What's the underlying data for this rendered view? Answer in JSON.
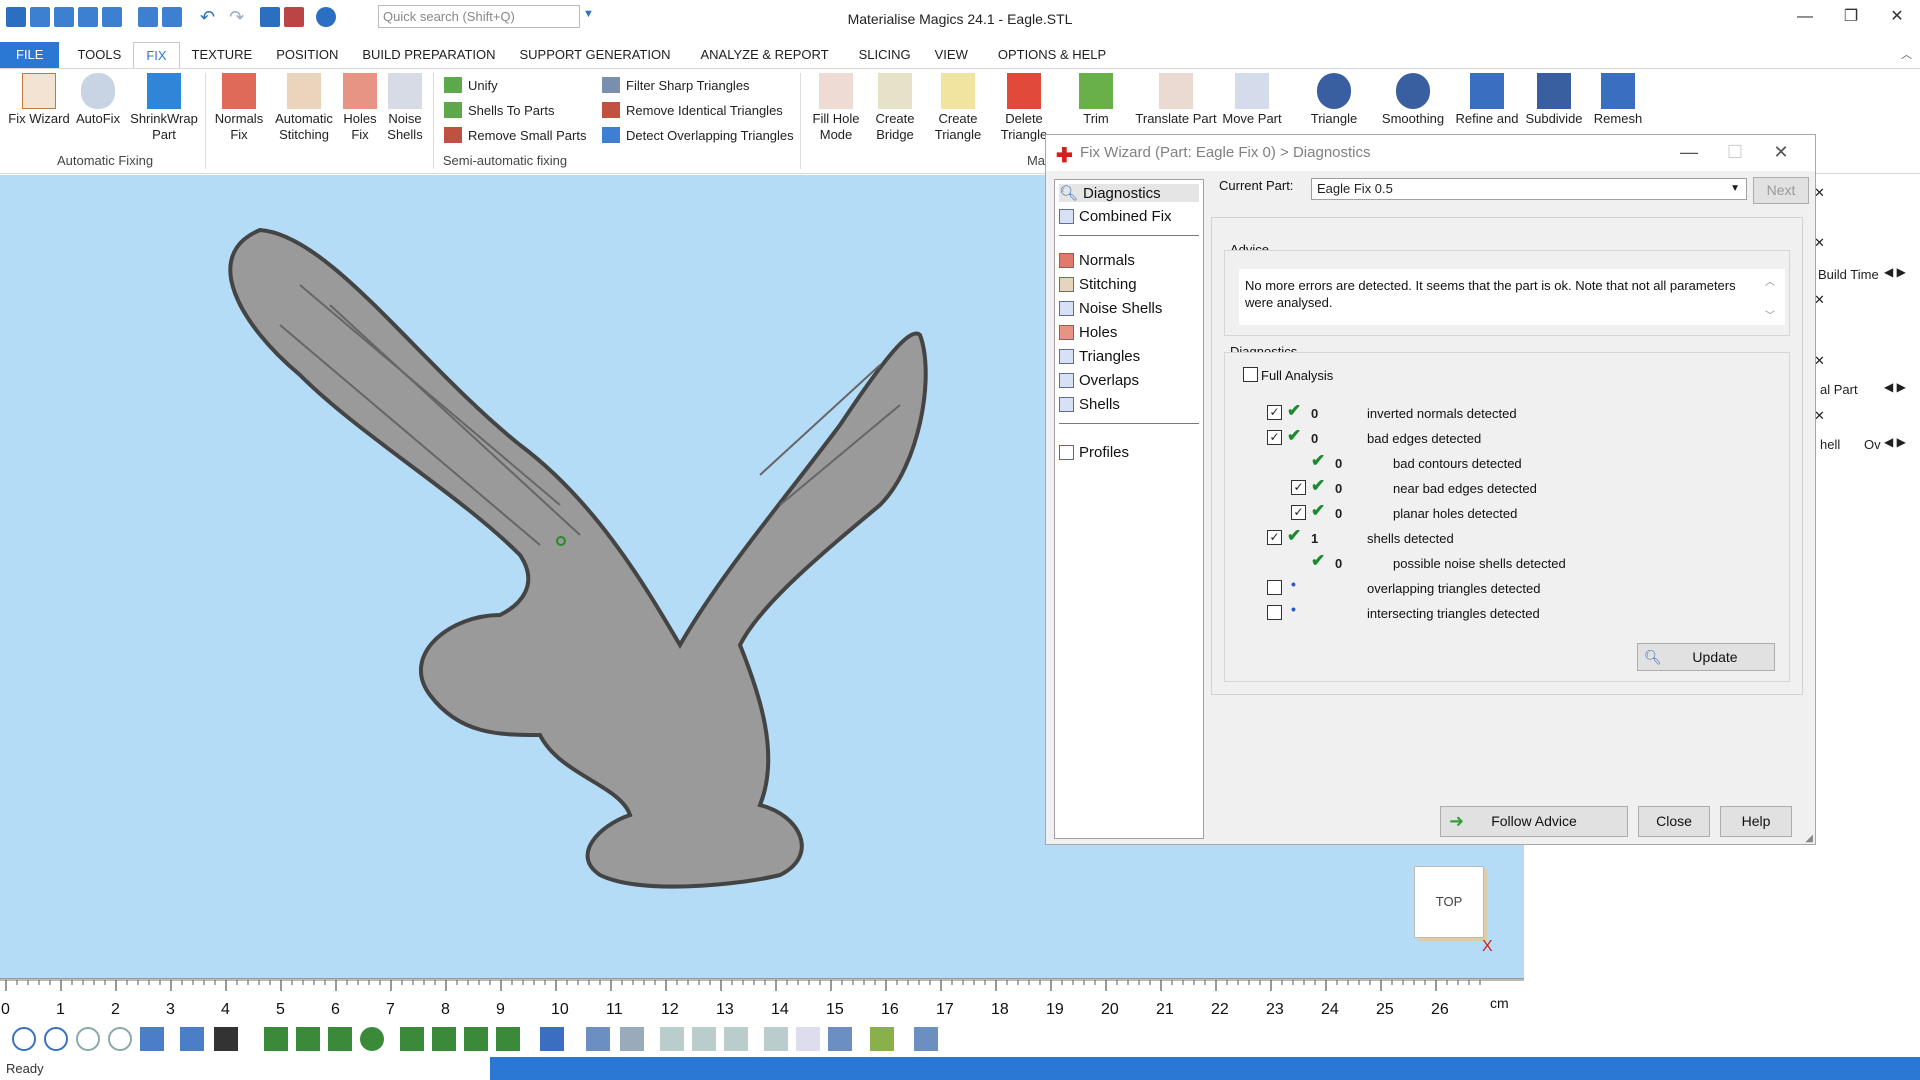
{
  "window": {
    "title": "Materialise Magics 24.1 - Eagle.STL",
    "search_placeholder": "Quick search (Shift+Q)"
  },
  "tabs": [
    "FILE",
    "TOOLS",
    "FIX",
    "TEXTURE",
    "POSITION",
    "BUILD PREPARATION",
    "SUPPORT GENERATION",
    "ANALYZE & REPORT",
    "SLICING",
    "VIEW",
    "OPTIONS & HELP"
  ],
  "ribbon": {
    "auto": {
      "fix_wizard": "Fix Wizard",
      "autofix": "AutoFix",
      "shrinkwrap1": "ShrinkWrap",
      "shrinkwrap2": "Part",
      "normals1": "Normals",
      "normals2": "Fix",
      "stitch1": "Automatic",
      "stitch2": "Stitching",
      "holes1": "Holes",
      "holes2": "Fix",
      "noise1": "Noise",
      "noise2": "Shells",
      "group_label": "Automatic Fixing"
    },
    "semi": {
      "unify": "Unify",
      "shells_to_parts": "Shells To Parts",
      "remove_small_parts": "Remove Small Parts",
      "filter_sharp": "Filter Sharp Triangles",
      "remove_identical": "Remove Identical Triangles",
      "detect_overlapping": "Detect Overlapping Triangles",
      "group_label": "Semi-automatic fixing"
    },
    "manual": {
      "fillhole1": "Fill Hole",
      "fillhole2": "Mode",
      "bridge1": "Create",
      "bridge2": "Bridge",
      "ctri1": "Create",
      "ctri2": "Triangle",
      "dtri1": "Delete",
      "dtri2": "Triangle",
      "trim": "Trim",
      "translate": "Translate Part",
      "move": "Move Part",
      "triangle": "Triangle",
      "smoothing": "Smoothing",
      "refine1": "Refine and",
      "subdivide": "Subdivide",
      "remesh": "Remesh",
      "group_label": "Ma"
    }
  },
  "dialog": {
    "title": "Fix Wizard (Part: Eagle Fix  0) > Diagnostics",
    "nav": [
      "Diagnostics",
      "Combined Fix",
      "Normals",
      "Stitching",
      "Noise Shells",
      "Holes",
      "Triangles",
      "Overlaps",
      "Shells",
      "Profiles"
    ],
    "current_part_label": "Current Part:",
    "current_part_value": "Eagle Fix  0.5",
    "next": "Next",
    "advice_title": "Advice",
    "advice_text": "No more errors are detected. It seems that the part is ok. Note that not all parameters were analysed.",
    "diag_title": "Diagnostics",
    "full_analysis": "Full Analysis",
    "rows": [
      {
        "count": "0",
        "label": "inverted normals detected"
      },
      {
        "count": "0",
        "label": "bad edges detected"
      },
      {
        "count": "0",
        "label": "bad contours detected"
      },
      {
        "count": "0",
        "label": "near bad edges detected"
      },
      {
        "count": "0",
        "label": "planar holes detected"
      },
      {
        "count": "1",
        "label": "shells detected"
      },
      {
        "count": "0",
        "label": "possible noise shells detected"
      },
      {
        "count": "",
        "label": "overlapping triangles detected"
      },
      {
        "count": "",
        "label": "intersecting triangles detected"
      }
    ],
    "update": "Update",
    "follow_advice": "Follow Advice",
    "close": "Close",
    "help": "Help"
  },
  "right_panel": {
    "build_time": "Build Time",
    "part_frag": "al Part",
    "shell_frag": "hell",
    "ov_frag": "Ov"
  },
  "view_cube": "TOP",
  "ruler": {
    "ticks": [
      "0",
      "1",
      "2",
      "3",
      "4",
      "5",
      "6",
      "7",
      "8",
      "9",
      "10",
      "11",
      "12",
      "13",
      "14",
      "15",
      "16",
      "17",
      "18",
      "19",
      "20",
      "21",
      "22",
      "23",
      "24",
      "25",
      "26"
    ],
    "unit": "cm"
  },
  "status": "Ready",
  "colors": {
    "accent": "#2b78d4",
    "viewport": "#b5dcf6",
    "check": "#1c8a2e"
  }
}
